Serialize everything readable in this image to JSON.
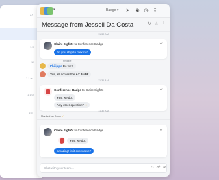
{
  "window": {
    "badge_label": "Badge",
    "icons": [
      "send-icon",
      "mention-icon",
      "clock-icon",
      "download-icon",
      "more-icon"
    ]
  },
  "background_list": {
    "timestamps": [
      "1:5",
      "11",
      "1 1 ts",
      "1:1:0",
      "1:5"
    ]
  },
  "conversation": {
    "title": "Message from Jessell Da Costa",
    "composer_placeholder": "Chat with your team...",
    "accent_color": "#1a73e8"
  },
  "timeline": {
    "t1": "11:30 AM",
    "t2": "11:31 AM",
    "t3": "11:32 AM",
    "t4": "11:33 AM",
    "t5": "11:35 AM"
  },
  "messages": {
    "m1": {
      "sender": "Claire Sigfröt",
      "to_word": "to",
      "recipient": "Conference Badge",
      "text": "do you ship to mexico?"
    },
    "m2": {
      "tiny_label": "Philippe",
      "mention": "Philippe",
      "text": "Do we?",
      "reply_prefix": "Yes, all across the",
      "reply_bold": "AZ & ibE"
    },
    "m3": {
      "sender": "Conference Badge",
      "to_word": "to",
      "recipient": "Claire Sigfröt",
      "reply1": "Yes, we do.",
      "reply2": "Any other question?"
    },
    "note": "Marked as Done",
    "m4": {
      "sender": "Claire Sigfröt",
      "to_word": "to",
      "recipient": "Conference Badge",
      "quote": "Yes, we do.",
      "text": "amazing! is it expensive?"
    }
  }
}
